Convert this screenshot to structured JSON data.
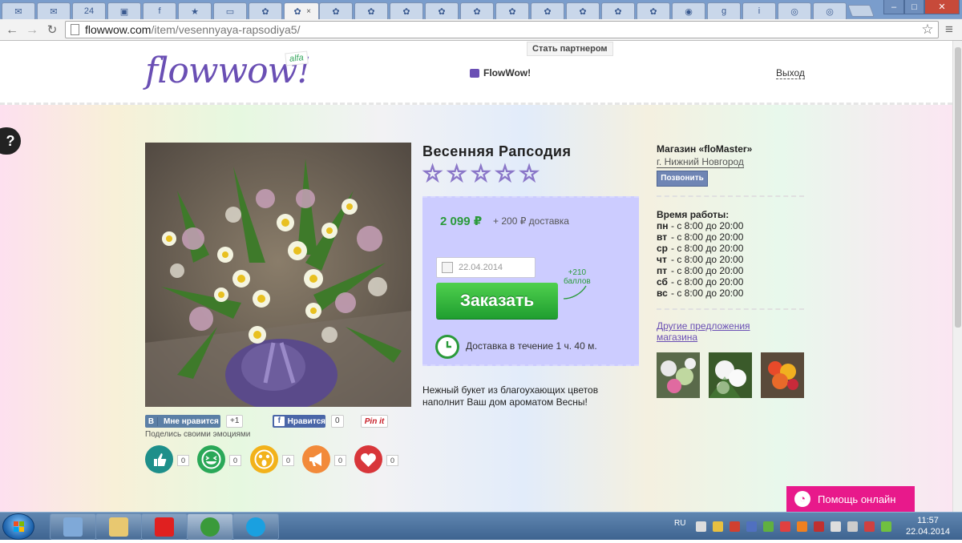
{
  "browser": {
    "tabs": [
      {
        "icon": "mail-icon",
        "glyph": "✉"
      },
      {
        "icon": "mail-icon",
        "glyph": "✉"
      },
      {
        "icon": "number-icon",
        "glyph": "24"
      },
      {
        "icon": "message-icon",
        "glyph": "▣"
      },
      {
        "icon": "facebook-icon",
        "glyph": "f"
      },
      {
        "icon": "star-icon",
        "glyph": "★"
      },
      {
        "icon": "red-page-icon",
        "glyph": "▭"
      },
      {
        "icon": "flowwow-flower-icon",
        "glyph": "✿"
      },
      {
        "icon": "flowwow-flower-icon",
        "glyph": "✿",
        "active": true
      },
      {
        "icon": "flowwow-flower-icon",
        "glyph": "✿"
      },
      {
        "icon": "flowwow-flower-icon",
        "glyph": "✿"
      },
      {
        "icon": "flowwow-flower-icon",
        "glyph": "✿"
      },
      {
        "icon": "flowwow-flower-icon",
        "glyph": "✿"
      },
      {
        "icon": "flowwow-flower-icon",
        "glyph": "✿"
      },
      {
        "icon": "flowwow-flower-icon",
        "glyph": "✿"
      },
      {
        "icon": "flowwow-flower-icon",
        "glyph": "✿"
      },
      {
        "icon": "flowwow-flower-icon",
        "glyph": "✿"
      },
      {
        "icon": "flowwow-flower-icon",
        "glyph": "✿"
      },
      {
        "icon": "flowwow-flower-icon",
        "glyph": "✿"
      },
      {
        "icon": "chat-bubble-icon",
        "glyph": "◉"
      },
      {
        "icon": "google-icon",
        "glyph": "g"
      },
      {
        "icon": "info-icon",
        "glyph": "i"
      },
      {
        "icon": "eye-icon",
        "glyph": "◎"
      },
      {
        "icon": "eye-icon",
        "glyph": "◎"
      }
    ],
    "close_glyph": "×",
    "window_controls": {
      "minimize": "–",
      "maximize": "□",
      "close": "✕"
    },
    "url_host": "flowwow.com",
    "url_path": "/item/vesennyaya-rapsodiya5/"
  },
  "header": {
    "logo": "flowwow!",
    "logo_badge": "alfa",
    "partner_label": "Стать партнером",
    "brand_link": "FlowWow!",
    "logout": "Выход",
    "help_glyph": "?"
  },
  "product": {
    "title": "Весенняя Рапсодия",
    "rating": 0,
    "max_rating": 5,
    "price": "2 099 ₽",
    "delivery_price": "+ 200 ₽ доставка",
    "date_placeholder": "22.04.2014",
    "order_button": "Заказать",
    "bonus_line1": "+210",
    "bonus_line2": "баллов",
    "delivery_time": "Доставка в течение 1 ч. 40 м.",
    "description": "Нежный букет из благоухающих цветов наполнит Ваш дом ароматом Весны!"
  },
  "social": {
    "vk_like": "Мне нравится",
    "vk_count": "+1",
    "fb_like": "Нравится",
    "fb_count": "0",
    "pinit": "Pin it",
    "emotions_label": "Поделись своими эмоциями",
    "emotions": [
      {
        "name": "thumbs-up",
        "color": "#1e8f8a",
        "count": "0"
      },
      {
        "name": "laugh",
        "color": "#2aa858",
        "count": "0"
      },
      {
        "name": "surprise",
        "color": "#f2b21a",
        "count": "0"
      },
      {
        "name": "megaphone",
        "color": "#f28a3a",
        "count": "0"
      },
      {
        "name": "heart",
        "color": "#d8363a",
        "count": "0"
      }
    ]
  },
  "shop": {
    "name": "Магазин «floMaster»",
    "city": "г. Нижний Новгород",
    "call_button": "Позвонить",
    "hours_title": "Время работы:",
    "hours": [
      {
        "day": "пн",
        "time": "- с 8:00 до 20:00"
      },
      {
        "day": "вт",
        "time": "- с 8:00 до 20:00"
      },
      {
        "day": "ср",
        "time": "- с 8:00 до 20:00"
      },
      {
        "day": "чт",
        "time": "- с 8:00 до 20:00"
      },
      {
        "day": "пт",
        "time": "- с 8:00 до 20:00"
      },
      {
        "day": "сб",
        "time": "- с 8:00 до 20:00"
      },
      {
        "day": "вс",
        "time": "- с 8:00 до 20:00"
      }
    ],
    "other_offers": "Другие предложения магазина"
  },
  "help_online": "Помощь онлайн",
  "taskbar": {
    "apps": [
      {
        "name": "calculator-icon",
        "color": "#7fa9d8"
      },
      {
        "name": "file-explorer-icon",
        "color": "#e8c870"
      },
      {
        "name": "yandex-browser-icon",
        "color": "#e02020"
      },
      {
        "name": "chrome-icon",
        "color": "#3a9a3a",
        "active": true
      },
      {
        "name": "skype-icon",
        "color": "#1aa0e0"
      }
    ],
    "lang": "RU",
    "time": "11:57",
    "date": "22.04.2014"
  },
  "colors": {
    "accent_purple": "#6a4fb4",
    "price_green": "#2a9a3a",
    "order_green": "#2eb83a",
    "help_pink": "#e8198b"
  }
}
